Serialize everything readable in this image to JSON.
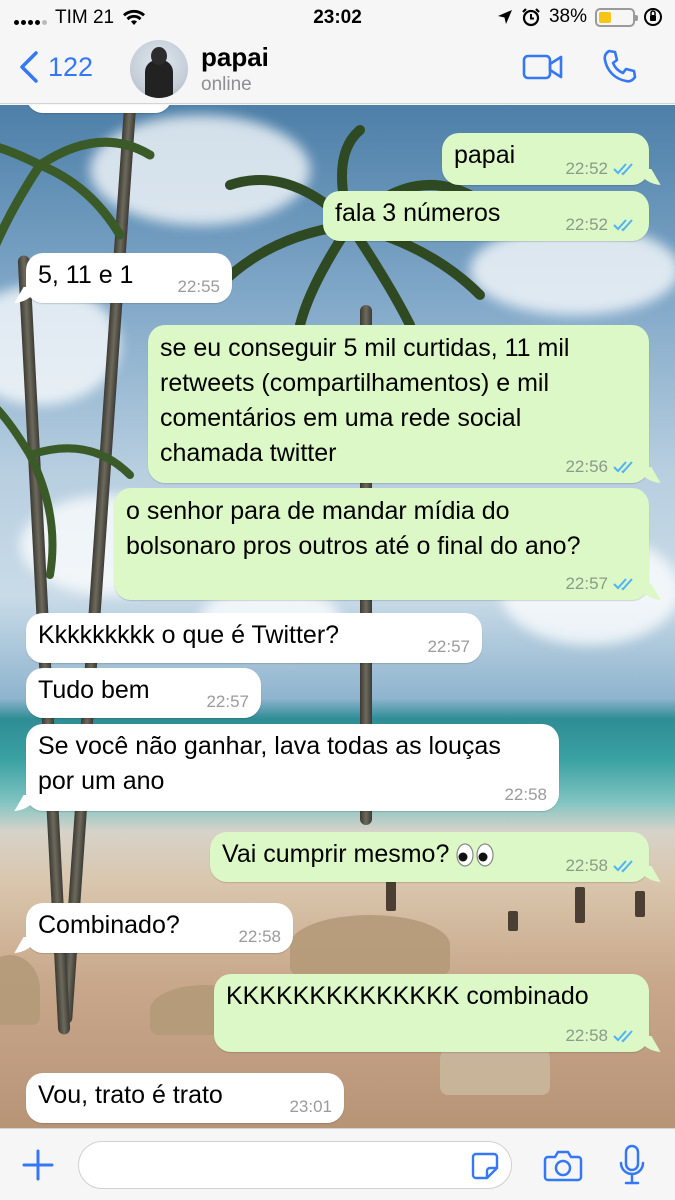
{
  "status_bar": {
    "carrier": "TIM 21",
    "time": "23:02",
    "battery_percent": "38%",
    "battery_level": 0.38
  },
  "header": {
    "back_count": "122",
    "contact_name": "papai",
    "contact_status": "online"
  },
  "messages": [
    {
      "dir": "out",
      "text": "papai",
      "time": "22:52"
    },
    {
      "dir": "out",
      "text": "fala 3 números",
      "time": "22:52"
    },
    {
      "dir": "in",
      "text": "5, 11 e 1",
      "time": "22:55"
    },
    {
      "dir": "out",
      "text": "se eu conseguir 5 mil curtidas, 11 mil\nretweets (compartilhamentos) e mil\ncomentários em uma rede social\nchamada twitter",
      "time": "22:56"
    },
    {
      "dir": "out",
      "text": "o senhor para de mandar mídia do\nbolsonaro pros outros até o final do ano?",
      "time": "22:57"
    },
    {
      "dir": "in",
      "text": "Kkkkkkkkk o que é Twitter?",
      "time": "22:57"
    },
    {
      "dir": "in",
      "text": "Tudo bem",
      "time": "22:57"
    },
    {
      "dir": "in",
      "text": "Se você não ganhar, lava todas as louças\npor um ano",
      "time": "22:58"
    },
    {
      "dir": "out",
      "text": "Vai cumprir mesmo?",
      "time": "22:58"
    },
    {
      "dir": "in",
      "text": "Combinado?",
      "time": "22:58"
    },
    {
      "dir": "out",
      "text": "KKKKKKKKKKKKKK combinado",
      "time": "22:58"
    },
    {
      "dir": "in",
      "text": "Vou, trato é trato",
      "time": "23:01"
    }
  ],
  "input": {
    "placeholder": ""
  },
  "colors": {
    "accent": "#3478f6",
    "outgoing_bubble": "#dcf8c6",
    "incoming_bubble": "#ffffff",
    "read_ticks": "#4fb3f6",
    "battery": "#f5c518"
  },
  "icons": [
    "back-chevron-icon",
    "video-call-icon",
    "phone-icon",
    "plus-icon",
    "sticker-icon",
    "camera-icon",
    "microphone-icon",
    "read-receipt-icon",
    "eyes-emoji-icon"
  ]
}
